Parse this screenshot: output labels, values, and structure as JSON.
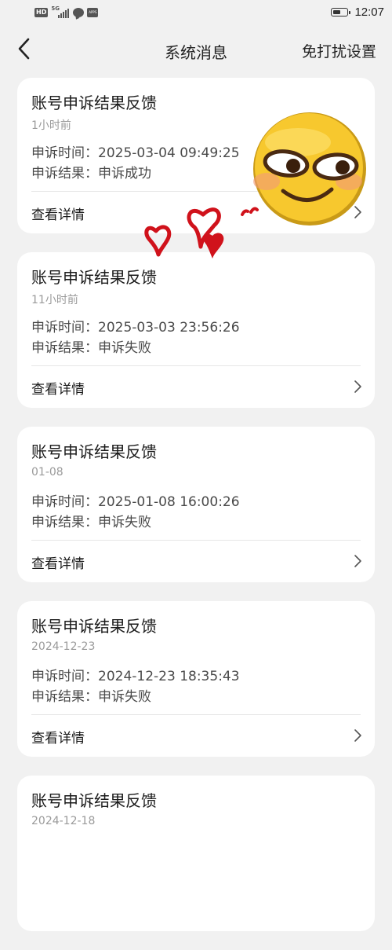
{
  "status_bar": {
    "hd_label": "HD",
    "network_label": "5G",
    "time": "12:07",
    "icons": [
      "hd-icon",
      "signal-icon",
      "chat-bubble-icon",
      "app-tile-icon",
      "battery-icon"
    ]
  },
  "nav": {
    "back_icon": "chevron-left-icon",
    "title": "系统消息",
    "action": "免打扰设置"
  },
  "messages": [
    {
      "title": "账号申诉结果反馈",
      "time": "1小时前",
      "line1_label": "申诉时间：",
      "line1_value": "2025-03-04 09:49:25",
      "line2_label": "申诉结果：",
      "line2_value": "申诉成功",
      "action": "查看详情"
    },
    {
      "title": "账号申诉结果反馈",
      "time": "11小时前",
      "line1_label": "申诉时间：",
      "line1_value": "2025-03-03 23:56:26",
      "line2_label": "申诉结果：",
      "line2_value": "申诉失败",
      "action": "查看详情"
    },
    {
      "title": "账号申诉结果反馈",
      "time": "01-08",
      "line1_label": "申诉时间：",
      "line1_value": "2025-01-08 16:00:26",
      "line2_label": "申诉结果：",
      "line2_value": "申诉失败",
      "action": "查看详情"
    },
    {
      "title": "账号申诉结果反馈",
      "time": "2024-12-23",
      "line1_label": "申诉时间：",
      "line1_value": "2024-12-23 18:35:43",
      "line2_label": "申诉结果：",
      "line2_value": "申诉失败",
      "action": "查看详情"
    },
    {
      "title": "账号申诉结果反馈",
      "time": "2024-12-18"
    }
  ],
  "colors": {
    "background": "#f1f1f1",
    "card": "#ffffff",
    "primary_text": "#1a1a1a",
    "secondary_text": "#9a9a9a",
    "body_text": "#4a4a4a",
    "heart_red": "#d0121b",
    "emoji_yellow": "#f7c82e"
  },
  "sticker": {
    "type": "smirking-emoji-with-hearts",
    "icons": [
      "smirk-emoji-icon",
      "heart-icon"
    ]
  }
}
